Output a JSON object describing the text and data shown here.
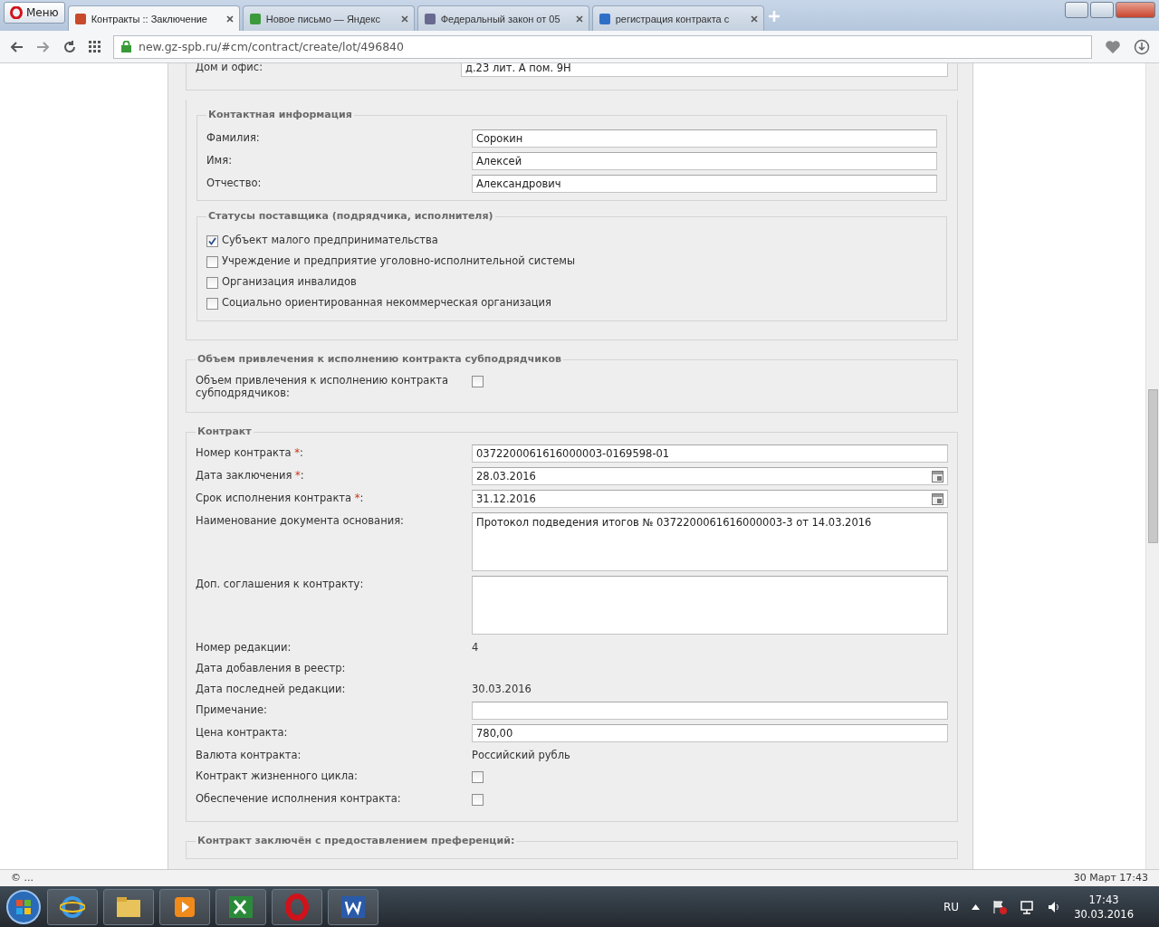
{
  "browser": {
    "menu_label": "Меню",
    "tabs": [
      {
        "title": "Контракты :: Заключение",
        "selected": true
      },
      {
        "title": "Новое письмо — Яндекс",
        "selected": false
      },
      {
        "title": "Федеральный закон от 05",
        "selected": false
      },
      {
        "title": "регистрация контракта с",
        "selected": false
      }
    ],
    "address": "new.gz-spb.ru/#cm/contract/create/lot/496840"
  },
  "form": {
    "address_rows": [
      {
        "label": "Дом и офис:",
        "value": "д.23 лит. А пом. 9Н"
      }
    ],
    "contact": {
      "legend": "Контактная информация",
      "rows": [
        {
          "label": "Фамилия:",
          "value": "Сорокин"
        },
        {
          "label": "Имя:",
          "value": "Алексей"
        },
        {
          "label": "Отчество:",
          "value": "Александрович"
        }
      ]
    },
    "statuses": {
      "legend": "Статусы поставщика (подрядчика, исполнителя)",
      "items": [
        {
          "label": "Субъект малого предпринимательства",
          "checked": true
        },
        {
          "label": "Учреждение и предприятие уголовно-исполнительной системы",
          "checked": false
        },
        {
          "label": "Организация инвалидов",
          "checked": false
        },
        {
          "label": "Социально ориентированная некоммерческая организация",
          "checked": false
        }
      ]
    },
    "subcontract": {
      "legend": "Объем привлечения к исполнению контракта субподрядчиков",
      "rows": [
        {
          "kind": "checkbox",
          "label": "Объем привлечения к исполнению контракта субподрядчиков:",
          "checked": false
        }
      ]
    },
    "contract": {
      "legend": "Контракт",
      "required_marker": "*",
      "rows": [
        {
          "kind": "input",
          "label": "Номер контракта",
          "required": true,
          "label_end": ":",
          "value": "0372200061616000003-0169598-01"
        },
        {
          "kind": "date",
          "label": "Дата заключения",
          "required": true,
          "label_end": ":",
          "value": "28.03.2016"
        },
        {
          "kind": "date",
          "label": "Срок исполнения контракта",
          "required": true,
          "label_end": ":",
          "value": "31.12.2016"
        },
        {
          "kind": "textarea",
          "label": "Наименование документа основания:",
          "value": "Протокол подведения итогов № 0372200061616000003-3 от 14.03.2016"
        },
        {
          "kind": "textarea",
          "label": "Доп. соглашения к контракту:"
        },
        {
          "kind": "text",
          "label": "Номер редакции:",
          "value": "4"
        },
        {
          "kind": "text",
          "label": "Дата добавления в реестр:"
        },
        {
          "kind": "text",
          "label": "Дата последней редакции:",
          "value": "30.03.2016"
        },
        {
          "kind": "input",
          "label": "Примечание:"
        },
        {
          "kind": "input",
          "label": "Цена контракта:",
          "value": "780,00"
        },
        {
          "kind": "text",
          "label": "Валюта контракта:",
          "value": "Российский рубль"
        },
        {
          "kind": "checkbox",
          "label": "Контракт жизненного цикла:",
          "checked": false
        },
        {
          "kind": "checkbox",
          "label": "Обеспечение исполнения контракта:",
          "checked": false
        }
      ]
    },
    "preferences": {
      "legend": "Контракт заключён с предоставлением преференций:"
    }
  },
  "status_bar": {
    "left": "© ...",
    "right": "30 Март 17:43"
  },
  "taskbar": {
    "language": "RU",
    "time": "17:43",
    "date": "30.03.2016"
  }
}
